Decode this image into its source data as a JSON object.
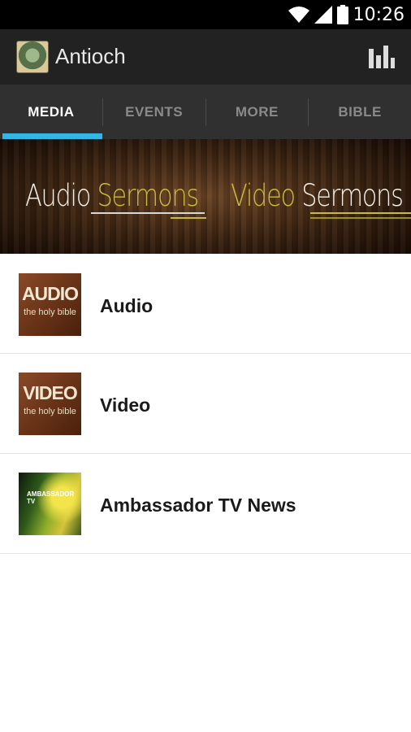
{
  "status_bar": {
    "time": "10:26",
    "icons": [
      "wifi-icon",
      "signal-icon",
      "battery-icon"
    ]
  },
  "action_bar": {
    "title": "Antioch",
    "logo": "church-logo",
    "action_icon": "bar-chart-icon"
  },
  "tabs": [
    {
      "label": "MEDIA",
      "active": true
    },
    {
      "label": "EVENTS",
      "active": false
    },
    {
      "label": "MORE",
      "active": false
    },
    {
      "label": "BIBLE",
      "active": false
    }
  ],
  "banner": {
    "audio": {
      "word1": "Audio",
      "word2": "Sermons"
    },
    "video": {
      "word1": "Video",
      "word2": "Sermons"
    }
  },
  "media_list": [
    {
      "label": "Audio",
      "thumb_big": "AUDIO",
      "thumb_small": "the holy bible"
    },
    {
      "label": "Video",
      "thumb_big": "VIDEO",
      "thumb_small": "the holy bible"
    },
    {
      "label": "Ambassador TV News",
      "thumb_text": "AMBASSADOR TV"
    }
  ],
  "colors": {
    "accent": "#33b5e5",
    "gold": "#c9ba3e",
    "action_bar": "#222222",
    "tab_bar": "#303030"
  }
}
